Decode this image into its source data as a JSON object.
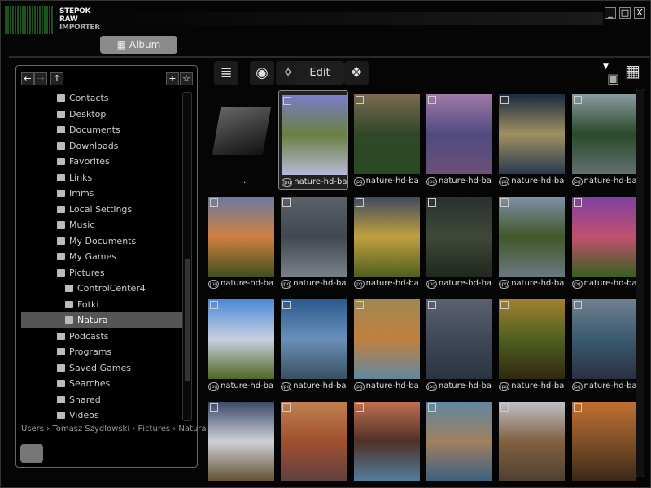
{
  "app": {
    "logo_lines": [
      "STEPOK",
      "RAW",
      "IMPORTER"
    ],
    "minimize": "_",
    "maximize": "□",
    "close": "X"
  },
  "tabs": {
    "album": "Album"
  },
  "nav": {
    "back": "←",
    "forward": "→",
    "up": "↑",
    "new": "+",
    "favorite": "☆"
  },
  "tree": {
    "items": [
      {
        "label": "Contacts",
        "level": 1
      },
      {
        "label": "Desktop",
        "level": 1
      },
      {
        "label": "Documents",
        "level": 1
      },
      {
        "label": "Downloads",
        "level": 1
      },
      {
        "label": "Favorites",
        "level": 1
      },
      {
        "label": "Links",
        "level": 1
      },
      {
        "label": "Imms",
        "level": 1
      },
      {
        "label": "Local Settings",
        "level": 1
      },
      {
        "label": "Music",
        "level": 1
      },
      {
        "label": "My Documents",
        "level": 1
      },
      {
        "label": "My Games",
        "level": 1
      },
      {
        "label": "Pictures",
        "level": 1
      },
      {
        "label": "ControlCenter4",
        "level": 2
      },
      {
        "label": "Fotki",
        "level": 2
      },
      {
        "label": "Natura",
        "level": 2,
        "selected": true
      },
      {
        "label": "Podcasts",
        "level": 1
      },
      {
        "label": "Programs",
        "level": 1
      },
      {
        "label": "Saved Games",
        "level": 1
      },
      {
        "label": "Searches",
        "level": 1
      },
      {
        "label": "Shared",
        "level": 1
      },
      {
        "label": "Videos",
        "level": 1
      }
    ]
  },
  "breadcrumb": "Users › Tomasz Szydlowski › Pictures › Natura",
  "toolbar": {
    "edit": "Edit"
  },
  "grid": {
    "parent_label": "..",
    "badge": "jpg",
    "items": [
      {
        "label": "nature-hd-ba",
        "colors": [
          "#7a7ec8",
          "#6a8040",
          "#b8b8d8"
        ],
        "selected": true
      },
      {
        "label": "nature-hd-ba",
        "colors": [
          "#7a6a50",
          "#304828",
          "#2a4a20"
        ]
      },
      {
        "label": "nature-hd-ba",
        "colors": [
          "#a07aa8",
          "#504a80",
          "#6a5078"
        ]
      },
      {
        "label": "nature-hd-ba",
        "colors": [
          "#1a2a40",
          "#a09060",
          "#2a3a50"
        ]
      },
      {
        "label": "nature-hd-ba",
        "colors": [
          "#8a9aa0",
          "#2a4a2a",
          "#607070"
        ]
      },
      {
        "label": "nature-hd-ba",
        "colors": [
          "#6a7aa0",
          "#d08040",
          "#405020"
        ]
      },
      {
        "label": "nature-hd-ba",
        "colors": [
          "#5a6068",
          "#404850",
          "#7a8088"
        ]
      },
      {
        "label": "nature-hd-ba",
        "colors": [
          "#404a60",
          "#c0a040",
          "#506020"
        ]
      },
      {
        "label": "nature-hd-ba",
        "colors": [
          "#2a3030",
          "#404838",
          "#202820"
        ]
      },
      {
        "label": "nature-hd-ba",
        "colors": [
          "#8090a8",
          "#405828",
          "#6a7880"
        ]
      },
      {
        "label": "nature-hd-ba",
        "colors": [
          "#8040a0",
          "#c05070",
          "#3a6020"
        ]
      },
      {
        "label": "nature-hd-ba",
        "colors": [
          "#4a88d8",
          "#c8d0e0",
          "#506820"
        ]
      },
      {
        "label": "nature-hd-ba",
        "colors": [
          "#2a5a90",
          "#6a90b8",
          "#3a5060"
        ]
      },
      {
        "label": "nature-hd-ba",
        "colors": [
          "#a08850",
          "#c08040",
          "#6088a0"
        ]
      },
      {
        "label": "nature-hd-ba",
        "colors": [
          "#5a6070",
          "#404858",
          "#2a3440"
        ]
      },
      {
        "label": "nature-hd-ba",
        "colors": [
          "#a08030",
          "#506020",
          "#302810"
        ]
      },
      {
        "label": "nature-hd-ba",
        "colors": [
          "#708090",
          "#3a5a70",
          "#2a3040"
        ]
      },
      {
        "label": "",
        "colors": [
          "#3a4a68",
          "#d0d0d8",
          "#605030"
        ]
      },
      {
        "label": "",
        "colors": [
          "#c08050",
          "#a05030",
          "#604040"
        ]
      },
      {
        "label": "",
        "colors": [
          "#c07050",
          "#503028",
          "#5080a0"
        ]
      },
      {
        "label": "",
        "colors": [
          "#6088a0",
          "#a08060",
          "#3a6080"
        ]
      },
      {
        "label": "",
        "colors": [
          "#c0c0c8",
          "#806040",
          "#504030"
        ]
      },
      {
        "label": "",
        "colors": [
          "#c07030",
          "#805028",
          "#3a2818"
        ]
      }
    ]
  }
}
